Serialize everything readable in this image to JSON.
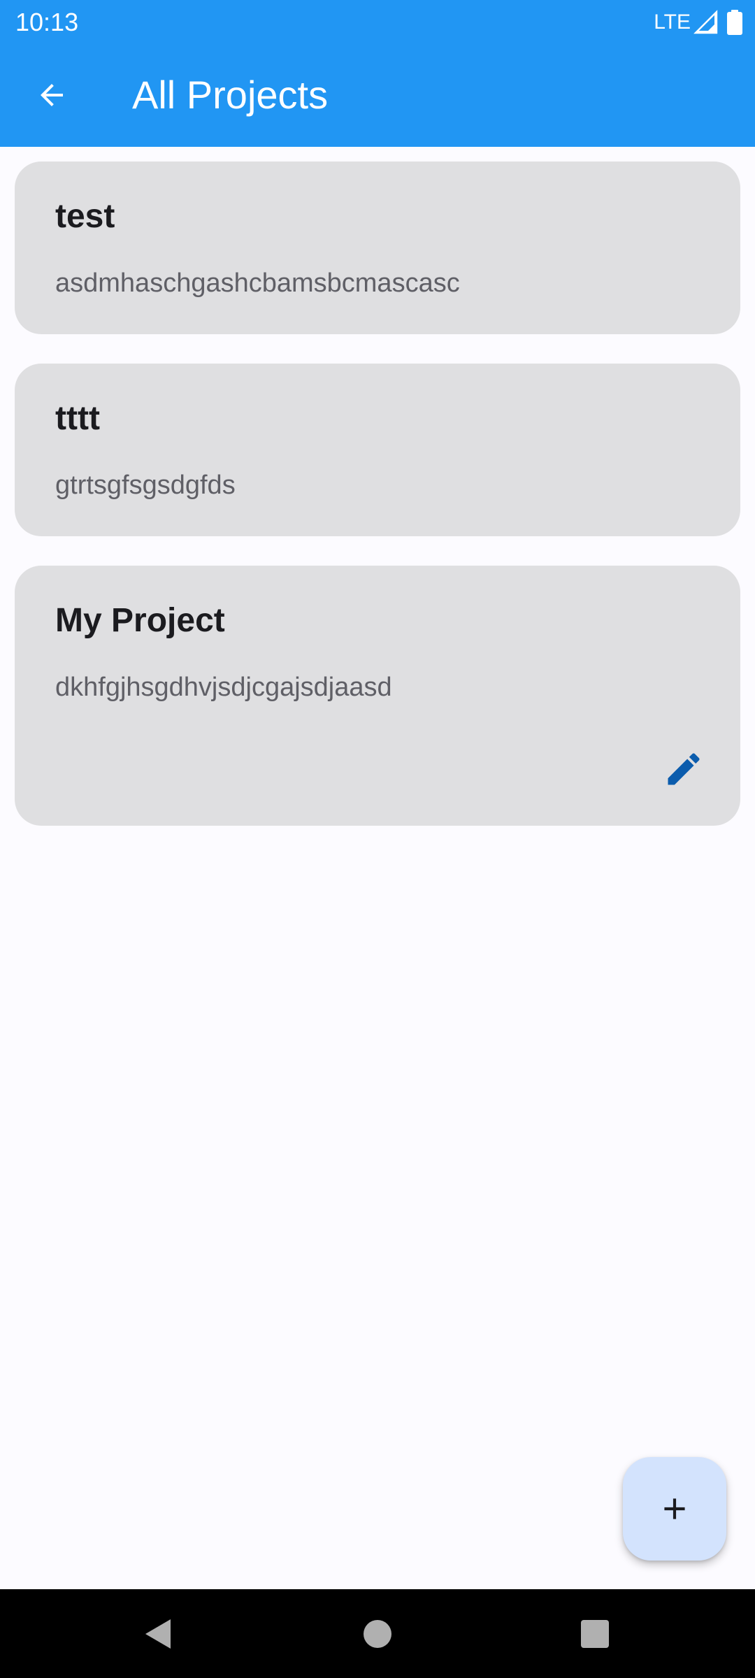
{
  "status_bar": {
    "time": "10:13",
    "network": "LTE",
    "icons": [
      "signal-icon",
      "battery-icon"
    ]
  },
  "app_bar": {
    "title": "All Projects",
    "back_icon": "arrow-back-icon",
    "background_color": "#2196f3"
  },
  "projects": [
    {
      "title": "test",
      "description": "asdmhaschgashcbamsbcmascasc",
      "editable": false
    },
    {
      "title": "tttt",
      "description": "gtrtsgfsgsdgfds",
      "editable": false
    },
    {
      "title": "My Project",
      "description": "dkhfgjhsgdhvjsdjcgajsdjaasd",
      "editable": true,
      "edit_icon": "pencil-edit-icon"
    }
  ],
  "fab": {
    "icon": "plus-icon",
    "background_color": "#d3e3fd"
  },
  "nav_bar": {
    "buttons": [
      "back-triangle-icon",
      "home-circle-icon",
      "recents-square-icon"
    ]
  },
  "colors": {
    "card_background": "#dfdfe1",
    "edit_icon_color": "#0b5cad",
    "page_background": "#fcfbff"
  }
}
